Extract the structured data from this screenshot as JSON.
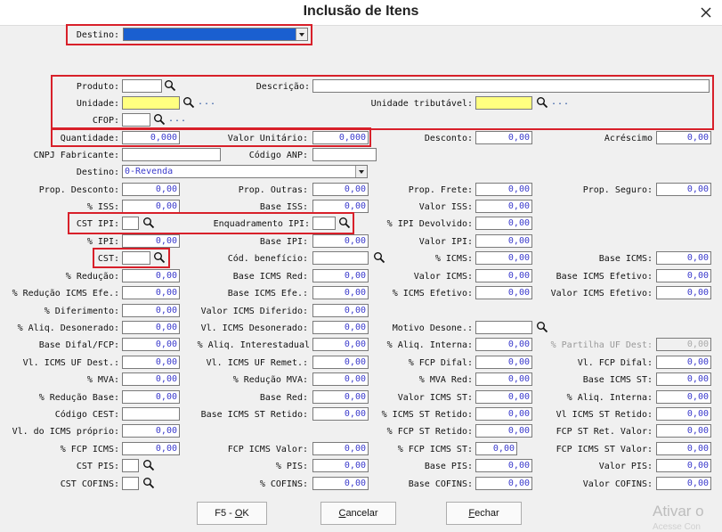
{
  "window": {
    "title": "Inclusão de Itens"
  },
  "top_destino": {
    "label": "Destino:"
  },
  "produto": {
    "label": "Produto:",
    "descricao_label": "Descrição:"
  },
  "unidade": {
    "label": "Unidade:",
    "tributavel_label": "Unidade tributável:",
    "more": "..."
  },
  "cfop": {
    "label": "CFOP:",
    "more": "..."
  },
  "row4": {
    "quantidade_label": "Quantidade:",
    "quantidade": "0,000",
    "valor_unit_label": "Valor Unitário:",
    "valor_unit": "0,000",
    "desconto_label": "Desconto:",
    "desconto": "0,00",
    "acrescimo_label": "Acréscimo",
    "acrescimo": "0,00"
  },
  "row5": {
    "cnpj_label": "CNPJ Fabricante:",
    "anp_label": "Código ANP:"
  },
  "row6": {
    "destino_label": "Destino:",
    "destino_value": "0-Revenda"
  },
  "row7": {
    "prop_desconto_label": "Prop. Desconto:",
    "prop_desconto": "0,00",
    "prop_outras_label": "Prop. Outras:",
    "prop_outras": "0,00",
    "prop_frete_label": "Prop. Frete:",
    "prop_frete": "0,00",
    "prop_seguro_label": "Prop. Seguro:",
    "prop_seguro": "0,00"
  },
  "row8": {
    "iss_label": "% ISS:",
    "iss": "0,00",
    "base_iss_label": "Base ISS:",
    "base_iss": "0,00",
    "valor_iss_label": "Valor ISS:",
    "valor_iss": "0,00"
  },
  "row9": {
    "cst_ipi_label": "CST IPI:",
    "enq_ipi_label": "Enquadramento IPI:",
    "ipi_devolvido_label": "% IPI Devolvido:",
    "ipi_devolvido": "0,00"
  },
  "row10": {
    "ipi_label": "% IPI:",
    "ipi": "0,00",
    "base_ipi_label": "Base IPI:",
    "base_ipi": "0,00",
    "valor_ipi_label": "Valor IPI:",
    "valor_ipi": "0,00"
  },
  "row11": {
    "cst_label": "CST:",
    "cod_beneficio_label": "Cód. benefício:",
    "icms_label": "% ICMS:",
    "icms": "0,00",
    "base_icms_label": "Base ICMS:",
    "base_icms": "0,00"
  },
  "row12": {
    "reducao_label": "% Redução:",
    "reducao": "0,00",
    "base_icms_red_label": "Base ICMS Red:",
    "base_icms_red": "0,00",
    "valor_icms_label": "Valor ICMS:",
    "valor_icms": "0,00",
    "base_icms_efetivo_label": "Base ICMS Efetivo:",
    "base_icms_efetivo": "0,00"
  },
  "row13": {
    "reducao_efe_label": "% Redução ICMS Efe.:",
    "reducao_efe": "0,00",
    "base_icms_efe_label": "Base ICMS Efe.:",
    "base_icms_efe": "0,00",
    "icms_efetivo_label": "% ICMS Efetivo:",
    "icms_efetivo": "0,00",
    "valor_icms_efetivo_label": "Valor ICMS Efetivo:",
    "valor_icms_efetivo": "0,00"
  },
  "row14": {
    "diferimento_label": "% Diferimento:",
    "diferimento": "0,00",
    "valor_icms_diferido_label": "Valor ICMS Diferido:",
    "valor_icms_diferido": "0,00"
  },
  "row15": {
    "aliq_desonerado_label": "% Aliq. Desonerado:",
    "aliq_desonerado": "0,00",
    "vl_icms_desonerado_label": "Vl. ICMS Desonerado:",
    "vl_icms_desonerado": "0,00",
    "motivo_desone_label": "Motivo Desone.:"
  },
  "row16": {
    "base_difal_label": "Base Difal/FCP:",
    "base_difal": "0,00",
    "aliq_interestadual_label": "% Aliq. Interestadual",
    "aliq_interestadual": "0,00",
    "aliq_interna_label": "% Aliq. Interna:",
    "aliq_interna": "0,00",
    "partilha_label": "% Partilha UF Dest:",
    "partilha": "0,00"
  },
  "row17": {
    "vl_icms_uf_dest_label": "Vl. ICMS UF Dest.:",
    "vl_icms_uf_dest": "0,00",
    "vl_icms_uf_remet_label": "Vl. ICMS UF Remet.:",
    "vl_icms_uf_remet": "0,00",
    "fcp_difal_label": "% FCP Difal:",
    "fcp_difal": "0,00",
    "vl_fcp_difal_label": "Vl. FCP Difal:",
    "vl_fcp_difal": "0,00"
  },
  "row18": {
    "mva_label": "% MVA:",
    "mva": "0,00",
    "reducao_mva_label": "% Redução MVA:",
    "reducao_mva": "0,00",
    "mva_red_label": "% MVA Red:",
    "mva_red": "0,00",
    "base_icms_st_label": "Base ICMS ST:",
    "base_icms_st": "0,00"
  },
  "row19": {
    "reducao_base_label": "% Redução Base:",
    "reducao_base": "0,00",
    "base_red_label": "Base Red:",
    "base_red": "0,00",
    "valor_icms_st_label": "Valor ICMS ST:",
    "valor_icms_st": "0,00",
    "aliq_interna2_label": "% Aliq. Interna:",
    "aliq_interna2": "0,00"
  },
  "row20": {
    "codigo_cest_label": "Código CEST:",
    "base_icms_st_retido_label": "Base ICMS ST Retido:",
    "base_icms_st_retido": "0,00",
    "icms_st_retido_label": "% ICMS ST Retido:",
    "icms_st_retido": "0,00",
    "vl_icms_st_retido_label": "Vl ICMS ST Retido:",
    "vl_icms_st_retido": "0,00"
  },
  "row21": {
    "vl_icms_proprio_label": "Vl. do ICMS próprio:",
    "vl_icms_proprio": "0,00",
    "fcp_st_retido_label": "% FCP ST Retido:",
    "fcp_st_retido": "0,00",
    "fcp_st_ret_valor_label": "FCP ST Ret. Valor:",
    "fcp_st_ret_valor": "0,00"
  },
  "row22": {
    "fcp_icms_label": "% FCP ICMS:",
    "fcp_icms": "0,00",
    "fcp_icms_valor_label": "FCP ICMS Valor:",
    "fcp_icms_valor": "0,00",
    "fcp_icms_st_label": "% FCP ICMS ST:",
    "fcp_icms_st": "0,00",
    "fcp_icms_st_valor_label": "FCP ICMS ST Valor:",
    "fcp_icms_st_valor": "0,00"
  },
  "row23": {
    "cst_pis_label": "CST PIS:",
    "pis_label": "% PIS:",
    "pis": "0,00",
    "base_pis_label": "Base PIS:",
    "base_pis": "0,00",
    "valor_pis_label": "Valor PIS:",
    "valor_pis": "0,00"
  },
  "row24": {
    "cst_cofins_label": "CST COFINS:",
    "cofins_label": "% COFINS:",
    "cofins": "0,00",
    "base_cofins_label": "Base COFINS:",
    "base_cofins": "0,00",
    "valor_cofins_label": "Valor COFINS:",
    "valor_cofins": "0,00"
  },
  "buttons": {
    "ok_prefix": "F5 - ",
    "ok_key": "O",
    "ok_rest": "K",
    "cancel_key": "C",
    "cancel_rest": "ancelar",
    "close_key": "F",
    "close_rest": "echar"
  },
  "watermark": {
    "line1": "Ativar o",
    "line2": "Acesse Con"
  },
  "colors": {
    "highlight_red": "#d8202a",
    "value_blue": "#3a3acc",
    "yellow_field": "#ffff80",
    "selected_blue": "#1a5fd0"
  },
  "icons": [
    "close-icon",
    "dropdown-arrow-icon",
    "search-icon"
  ]
}
